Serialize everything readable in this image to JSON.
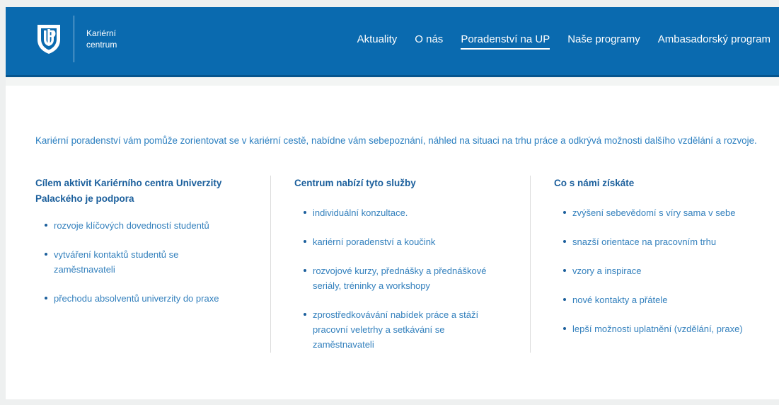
{
  "header": {
    "brand_line1": "Kariérní",
    "brand_line2": "centrum",
    "logo_icon": "up-logo-icon",
    "background": "#0a6aaf"
  },
  "nav": {
    "items": [
      {
        "label": "Aktuality",
        "active": false
      },
      {
        "label": "O nás",
        "active": false
      },
      {
        "label": "Poradenství na UP",
        "active": true
      },
      {
        "label": "Naše programy",
        "active": false
      },
      {
        "label": "Ambasadorský program",
        "active": false
      }
    ]
  },
  "intro": "Kariérní poradenství vám pomůže zorientovat se v kariérní cestě, nabídne vám sebepoznání, náhled na situaci na trhu práce a odkrývá možnosti dalšího vzdělání a rozvoje.",
  "columns": [
    {
      "title": "Cílem aktivit Kariérního centra Univerzity Palackého je podpora",
      "items": [
        "rozvoje klíčových dovedností studentů",
        "vytváření kontaktů studentů se zaměstnavateli",
        "přechodu absolventů univerzity do praxe"
      ]
    },
    {
      "title": "Centrum nabízí tyto služby",
      "items": [
        "individuální konzultace.",
        "kariérní poradenství a koučink",
        "rozvojové kurzy, přednášky a přednáškové seriály, tréninky a workshopy",
        "zprostředkovávání nabídek práce a stáží pracovní veletrhy a setkávání se zaměstnavateli"
      ]
    },
    {
      "title": "Co s námi získáte",
      "items": [
        "zvýšení sebevědomí s víry sama v sebe",
        "snazší orientace na pracovním trhu",
        "vzory a inspirace",
        "nové kontakty a přátele",
        "lepší možnosti uplatnění (vzdělání, praxe)"
      ]
    }
  ],
  "colors": {
    "accent": "#0a6aaf",
    "heading": "#1b5f9c",
    "text": "#3380bd"
  }
}
